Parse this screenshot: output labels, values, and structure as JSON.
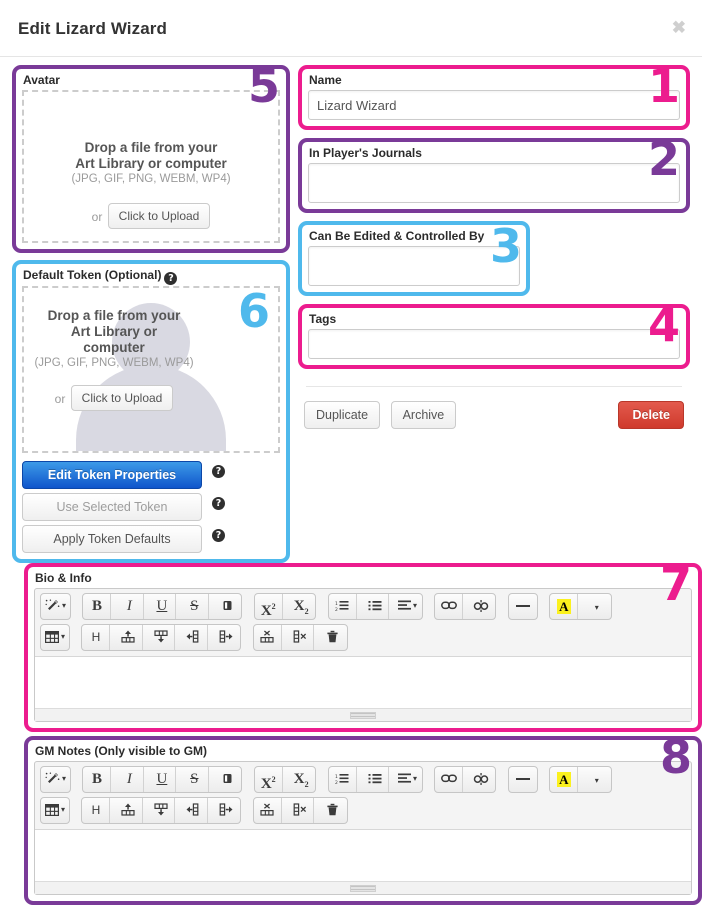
{
  "header": {
    "title": "Edit Lizard Wizard",
    "close_label": "✖"
  },
  "annotations": {
    "n1": "1",
    "n2": "2",
    "n3": "3",
    "n4": "4",
    "n5": "5",
    "n6": "6",
    "n7": "7",
    "n8": "8",
    "color_magenta": "#ec1c8e",
    "color_purple": "#7a3a98",
    "color_blue": "#4fb9ec"
  },
  "avatar": {
    "label": "Avatar",
    "drop_line1": "Drop a file from your",
    "drop_line2": "Art Library or computer",
    "formats": "(JPG, GIF, PNG, WEBM, WP4)",
    "or_word": "or",
    "upload_button": "Click to Upload"
  },
  "token": {
    "label": "Default Token (Optional)",
    "help_glyph": "?",
    "drop_line1": "Drop a file from your",
    "drop_line2": "Art Library or",
    "drop_line3": "computer",
    "formats": "(JPG, GIF, PNG, WEBM, WP4)",
    "or_word": "or",
    "upload_button": "Click to Upload",
    "buttons": [
      {
        "label": "Edit Token Properties",
        "style": "primary"
      },
      {
        "label": "Use Selected Token",
        "style": "muted"
      },
      {
        "label": "Apply Token Defaults",
        "style": "default"
      }
    ]
  },
  "fields": {
    "name": {
      "label": "Name",
      "value": "Lizard Wizard",
      "placeholder": ""
    },
    "journals": {
      "label": "In Player's Journals",
      "value": "",
      "placeholder": ""
    },
    "controlled_by": {
      "label": "Can Be Edited & Controlled By",
      "value": "",
      "placeholder": ""
    },
    "tags": {
      "label": "Tags",
      "value": "",
      "placeholder": ""
    }
  },
  "actions": {
    "duplicate": "Duplicate",
    "archive": "Archive",
    "delete": "Delete"
  },
  "editors": [
    {
      "id": "bio",
      "label": "Bio & Info",
      "annotation": "7",
      "annotation_color": "magenta",
      "content": ""
    },
    {
      "id": "gmnotes",
      "label": "GM Notes (Only visible to GM)",
      "annotation": "8",
      "annotation_color": "purple",
      "content": ""
    }
  ],
  "toolbar": {
    "row1": [
      {
        "group": 1,
        "name": "magic-wand-icon",
        "glyph": "wand",
        "caret": true
      },
      {
        "group": 2,
        "name": "bold-icon",
        "glyph": "B"
      },
      {
        "group": 2,
        "name": "italic-icon",
        "glyph": "I"
      },
      {
        "group": 2,
        "name": "underline-icon",
        "glyph": "U"
      },
      {
        "group": 2,
        "name": "strikethrough-icon",
        "glyph": "S"
      },
      {
        "group": 2,
        "name": "eraser-icon",
        "glyph": "eraser"
      },
      {
        "group": 3,
        "name": "superscript-icon",
        "glyph": "X2"
      },
      {
        "group": 3,
        "name": "subscript-icon",
        "glyph": "X2sub"
      },
      {
        "group": 4,
        "name": "ordered-list-icon",
        "glyph": "ol"
      },
      {
        "group": 4,
        "name": "unordered-list-icon",
        "glyph": "ul"
      },
      {
        "group": 4,
        "name": "align-icon",
        "glyph": "align",
        "caret": true
      },
      {
        "group": 5,
        "name": "link-icon",
        "glyph": "link"
      },
      {
        "group": 5,
        "name": "unlink-icon",
        "glyph": "unlink"
      },
      {
        "group": 6,
        "name": "horizontal-rule-icon",
        "glyph": "minus"
      },
      {
        "group": 7,
        "name": "text-color-icon",
        "glyph": "A"
      },
      {
        "group": 7,
        "name": "text-color-dropdown-icon",
        "glyph": "caret"
      }
    ],
    "row2": [
      {
        "group": 1,
        "name": "insert-table-icon",
        "glyph": "table",
        "caret": true
      },
      {
        "group": 2,
        "name": "table-header-icon",
        "glyph": "H"
      },
      {
        "group": 2,
        "name": "insert-row-above-icon",
        "glyph": "row-above"
      },
      {
        "group": 2,
        "name": "insert-row-below-icon",
        "glyph": "row-below"
      },
      {
        "group": 2,
        "name": "insert-column-left-icon",
        "glyph": "col-left"
      },
      {
        "group": 2,
        "name": "insert-column-right-icon",
        "glyph": "col-right"
      },
      {
        "group": 3,
        "name": "delete-row-icon",
        "glyph": "row-del"
      },
      {
        "group": 3,
        "name": "delete-column-icon",
        "glyph": "col-del"
      },
      {
        "group": 3,
        "name": "delete-table-icon",
        "glyph": "trash"
      }
    ]
  }
}
